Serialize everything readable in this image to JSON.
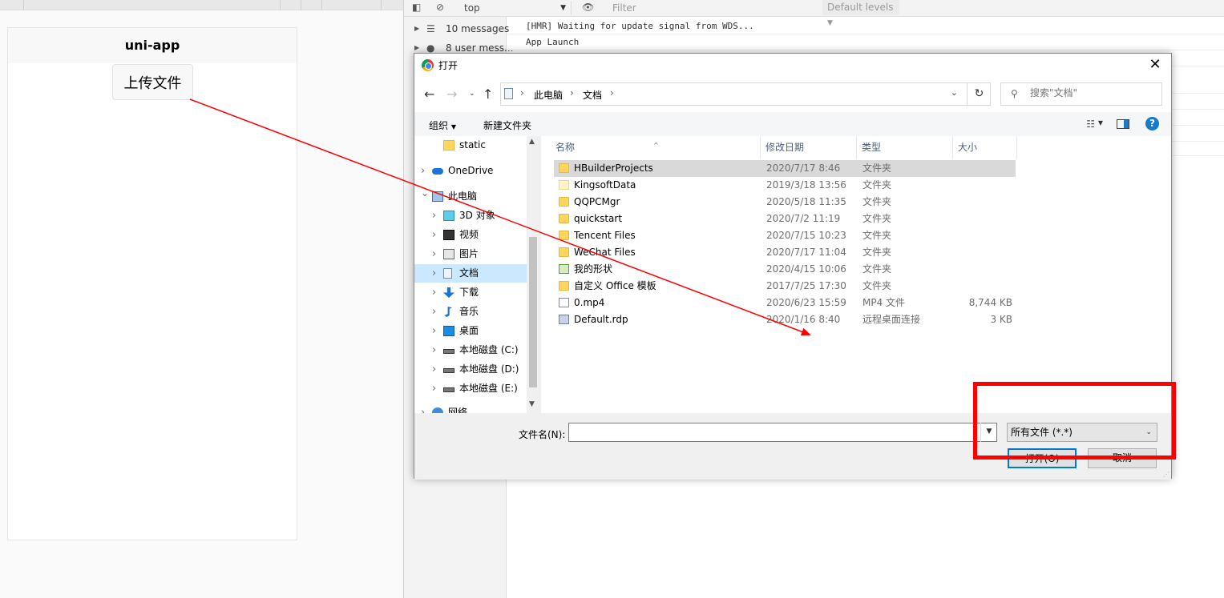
{
  "simulator": {
    "title": "uni-app",
    "upload_button": "上传文件"
  },
  "devtools": {
    "context": "top",
    "filter_placeholder": "Filter",
    "levels": "Default levels",
    "sidebar": [
      {
        "label": "10 messages",
        "icon": "list-icon"
      },
      {
        "label": "8 user mess...",
        "icon": "user-icon"
      }
    ],
    "console": [
      "[HMR] Waiting for update signal from WDS...",
      "App Launch"
    ]
  },
  "dialog": {
    "title": "打开",
    "breadcrumb": [
      "此电脑",
      "文档"
    ],
    "search_placeholder": "搜索\"文档\"",
    "organize": "组织",
    "new_folder": "新建文件夹",
    "help": "?",
    "nav_items": [
      {
        "label": "static",
        "icon": "folder-icon",
        "expandable": false,
        "indent": 1
      },
      {
        "label": "OneDrive",
        "icon": "cloud-icon",
        "expandable": true,
        "indent": 0
      },
      {
        "label": "此电脑",
        "icon": "computer-icon",
        "expandable": true,
        "expanded": true,
        "indent": 0
      },
      {
        "label": "3D 对象",
        "icon": "cube-icon",
        "expandable": true,
        "indent": 1
      },
      {
        "label": "视频",
        "icon": "video-icon",
        "expandable": true,
        "indent": 1
      },
      {
        "label": "图片",
        "icon": "picture-icon",
        "expandable": true,
        "indent": 1
      },
      {
        "label": "文档",
        "icon": "document-icon",
        "expandable": true,
        "indent": 1,
        "selected": true
      },
      {
        "label": "下载",
        "icon": "download-icon",
        "expandable": true,
        "indent": 1
      },
      {
        "label": "音乐",
        "icon": "music-icon",
        "expandable": true,
        "indent": 1
      },
      {
        "label": "桌面",
        "icon": "desktop-icon",
        "expandable": true,
        "indent": 1
      },
      {
        "label": "本地磁盘 (C:)",
        "icon": "drive-icon",
        "expandable": true,
        "indent": 1
      },
      {
        "label": "本地磁盘 (D:)",
        "icon": "drive-icon",
        "expandable": true,
        "indent": 1
      },
      {
        "label": "本地磁盘 (E:)",
        "icon": "drive-icon",
        "expandable": true,
        "indent": 1
      },
      {
        "label": "网络",
        "icon": "network-icon",
        "expandable": true,
        "indent": 0
      }
    ],
    "columns": [
      "名称",
      "修改日期",
      "类型",
      "大小"
    ],
    "files": [
      {
        "name": "HBuilderProjects",
        "date": "2020/7/17 8:46",
        "type": "文件夹",
        "size": "",
        "icon": "folder",
        "selected": true
      },
      {
        "name": "KingsoftData",
        "date": "2019/3/18 13:56",
        "type": "文件夹",
        "size": "",
        "icon": "folder-pale"
      },
      {
        "name": "QQPCMgr",
        "date": "2020/5/18 11:35",
        "type": "文件夹",
        "size": "",
        "icon": "folder"
      },
      {
        "name": "quickstart",
        "date": "2020/7/2 11:19",
        "type": "文件夹",
        "size": "",
        "icon": "folder"
      },
      {
        "name": "Tencent Files",
        "date": "2020/7/15 10:23",
        "type": "文件夹",
        "size": "",
        "icon": "folder"
      },
      {
        "name": "WeChat Files",
        "date": "2020/7/17 11:04",
        "type": "文件夹",
        "size": "",
        "icon": "folder"
      },
      {
        "name": "我的形状",
        "date": "2020/4/15 10:06",
        "type": "文件夹",
        "size": "",
        "icon": "file-shape"
      },
      {
        "name": "自定义 Office 模板",
        "date": "2017/7/25 17:30",
        "type": "文件夹",
        "size": "",
        "icon": "folder"
      },
      {
        "name": "0.mp4",
        "date": "2020/6/23 15:59",
        "type": "MP4 文件",
        "size": "8,744 KB",
        "icon": "file-mp4"
      },
      {
        "name": "Default.rdp",
        "date": "2020/1/16 8:40",
        "type": "远程桌面连接",
        "size": "3 KB",
        "icon": "file-rdp"
      }
    ],
    "filename_label": "文件名(N):",
    "filename_value": "",
    "filetype": "所有文件 (*.*)",
    "open_button": "打开(O)",
    "cancel_button": "取消"
  },
  "colors": {
    "annotation": "#ff0000",
    "selection": "#cce8ff",
    "accent": "#0078d7"
  }
}
